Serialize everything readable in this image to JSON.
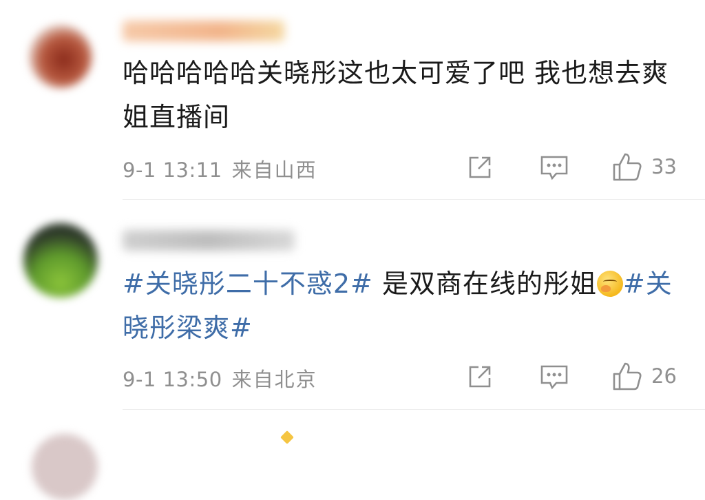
{
  "comments": [
    {
      "text": "哈哈哈哈哈关晓彤这也太可爱了吧 我也想去爽姐直播间",
      "time": "9-1 13:11",
      "location": "来自山西",
      "likes": "33"
    },
    {
      "tag1": "#关晓彤二十不惑2#",
      "text_mid": " 是双商在线的彤姐",
      "tag2": "#关晓彤梁爽#",
      "time": "9-1 13:50",
      "location": "来自北京",
      "likes": "26"
    }
  ],
  "icons": {
    "share": "share-icon",
    "comment": "comment-icon",
    "like": "thumbs-up-icon",
    "emoji": "thinking-emoji-icon"
  },
  "colors": {
    "text": "#1a1a1a",
    "meta": "#8f8f8f",
    "tag": "#3f6da8",
    "divider": "#ececec"
  }
}
